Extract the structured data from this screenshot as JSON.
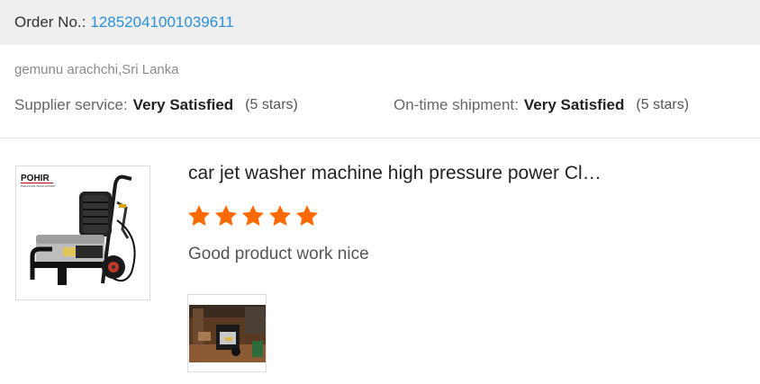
{
  "order": {
    "label": "Order No.:",
    "number": "12852041001039611"
  },
  "buyer": {
    "name_country": "gemunu arachchi,Sri Lanka"
  },
  "ratings": {
    "supplier_service": {
      "label": "Supplier service:",
      "value": "Very Satisfied",
      "stars_text": "(5 stars)"
    },
    "on_time_shipment": {
      "label": "On-time shipment:",
      "value": "Very Satisfied",
      "stars_text": "(5 stars)"
    }
  },
  "product": {
    "title": "car jet washer machine high pressure power Cl…",
    "brand_logo": "POHIR",
    "brand_tagline": "PRESSURE WASH EXPERT",
    "rating": 5,
    "rating_max": 5,
    "star_color": "#ff6a00"
  },
  "review": {
    "text": "Good product work nice"
  },
  "colors": {
    "link": "#2d8fd5",
    "order_bar_bg": "#efefef",
    "star": "#ff6a00"
  }
}
